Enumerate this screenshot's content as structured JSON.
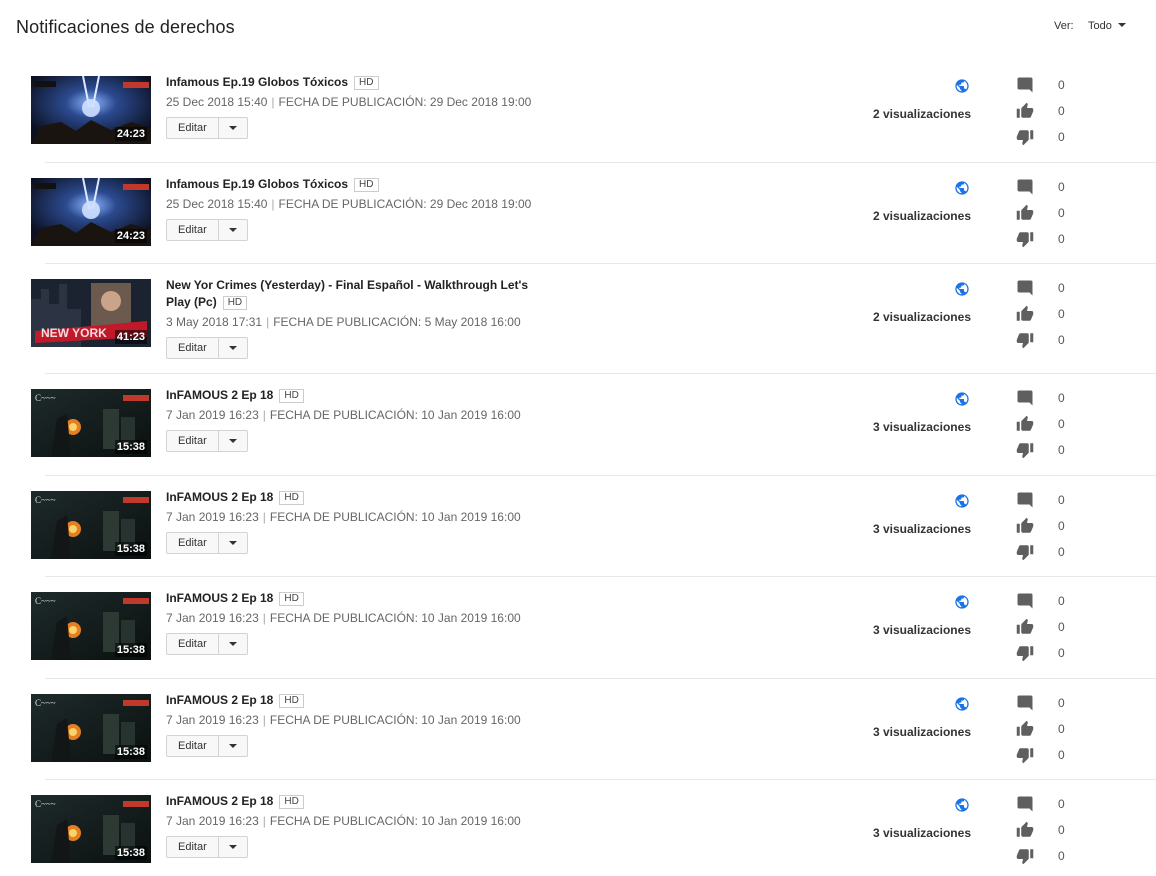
{
  "page_title": "Notificaciones de derechos",
  "filter": {
    "label": "Ver:",
    "value": "Todo"
  },
  "edit_label": "Editar",
  "hd_label": "HD",
  "colors": {
    "globe": "#1a73e8",
    "icon": "#5f5f5f"
  },
  "videos": [
    {
      "title": "Infamous Ep.19 Globos Tóxicos",
      "uploaded": "25 Dec 2018 15:40",
      "published": "FECHA DE PUBLICACIÓN: 29 Dec 2018 19:00",
      "duration": "24:23",
      "views": "2 visualizaciones",
      "comments": "0",
      "likes": "0",
      "dislikes": "0",
      "thumb": "infamous"
    },
    {
      "title": "Infamous Ep.19 Globos Tóxicos",
      "uploaded": "25 Dec 2018 15:40",
      "published": "FECHA DE PUBLICACIÓN: 29 Dec 2018 19:00",
      "duration": "24:23",
      "views": "2 visualizaciones",
      "comments": "0",
      "likes": "0",
      "dislikes": "0",
      "thumb": "infamous"
    },
    {
      "title": "New Yor Crimes (Yesterday) - Final Español - Walkthrough Let's Play (Pc)",
      "uploaded": "3 May 2018 17:31",
      "published": "FECHA DE PUBLICACIÓN: 5 May 2018 16:00",
      "duration": "41:23",
      "views": "2 visualizaciones",
      "comments": "0",
      "likes": "0",
      "dislikes": "0",
      "thumb": "nycrimes"
    },
    {
      "title": "InFAMOUS 2 Ep 18",
      "uploaded": "7 Jan 2019 16:23",
      "published": "FECHA DE PUBLICACIÓN: 10 Jan 2019 16:00",
      "duration": "15:38",
      "views": "3 visualizaciones",
      "comments": "0",
      "likes": "0",
      "dislikes": "0",
      "thumb": "infamous2"
    },
    {
      "title": "InFAMOUS 2 Ep 18",
      "uploaded": "7 Jan 2019 16:23",
      "published": "FECHA DE PUBLICACIÓN: 10 Jan 2019 16:00",
      "duration": "15:38",
      "views": "3 visualizaciones",
      "comments": "0",
      "likes": "0",
      "dislikes": "0",
      "thumb": "infamous2"
    },
    {
      "title": "InFAMOUS 2 Ep 18",
      "uploaded": "7 Jan 2019 16:23",
      "published": "FECHA DE PUBLICACIÓN: 10 Jan 2019 16:00",
      "duration": "15:38",
      "views": "3 visualizaciones",
      "comments": "0",
      "likes": "0",
      "dislikes": "0",
      "thumb": "infamous2"
    },
    {
      "title": "InFAMOUS 2 Ep 18",
      "uploaded": "7 Jan 2019 16:23",
      "published": "FECHA DE PUBLICACIÓN: 10 Jan 2019 16:00",
      "duration": "15:38",
      "views": "3 visualizaciones",
      "comments": "0",
      "likes": "0",
      "dislikes": "0",
      "thumb": "infamous2"
    },
    {
      "title": "InFAMOUS 2 Ep 18",
      "uploaded": "7 Jan 2019 16:23",
      "published": "FECHA DE PUBLICACIÓN: 10 Jan 2019 16:00",
      "duration": "15:38",
      "views": "3 visualizaciones",
      "comments": "0",
      "likes": "0",
      "dislikes": "0",
      "thumb": "infamous2"
    }
  ]
}
